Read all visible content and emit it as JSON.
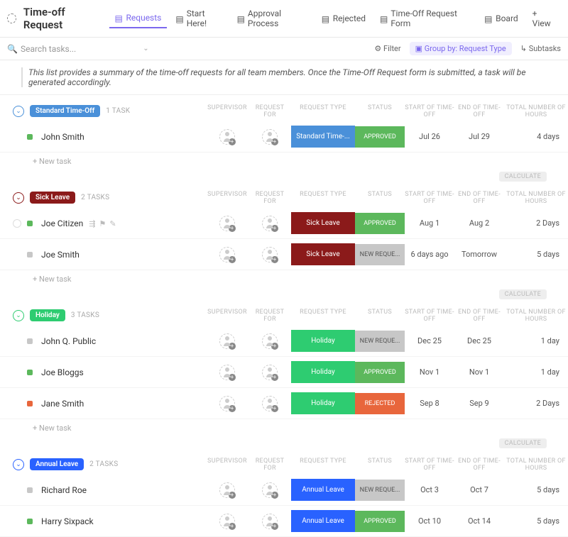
{
  "header": {
    "title": "Time-off Request",
    "views": [
      {
        "label": "Requests",
        "active": true
      },
      {
        "label": "Start Here!"
      },
      {
        "label": "Approval Process"
      },
      {
        "label": "Rejected"
      },
      {
        "label": "Time-Off Request Form"
      },
      {
        "label": "Board"
      }
    ],
    "add_view": "+ View"
  },
  "toolbar": {
    "search_placeholder": "Search tasks...",
    "filter": "Filter",
    "group_by": "Group by: Request Type",
    "subtasks": "Subtasks"
  },
  "description": "This list provides a summary of the time-off requests for all team members. Once the Time-Off Request form is submitted, a task will be generated accordingly.",
  "columns": {
    "supervisor": "SUPERVISOR",
    "request_for": "REQUEST FOR",
    "request_type": "REQUEST TYPE",
    "status": "STATUS",
    "start": "START OF TIME-OFF",
    "end": "END OF TIME-OFF",
    "total": "TOTAL NUMBER OF HOURS"
  },
  "new_task": "+ New task",
  "calculate": "CALCULATE",
  "colors": {
    "standard": "#4a90d9",
    "sick": "#8b1a1a",
    "holiday": "#2ecc71",
    "annual": "#2962ff",
    "approved": "#5cb85c",
    "new_request": "#c7c7c7",
    "rejected": "#e8663c"
  },
  "groups": [
    {
      "name": "Standard Time-Off",
      "count": "1 TASK",
      "color": "#4a90d9",
      "tasks": [
        {
          "name": "John Smith",
          "sq": "#5cb85c",
          "type": "Standard Time-...",
          "type_bg": "#4a90d9",
          "status": "APPROVED",
          "status_bg": "#5cb85c",
          "start": "Jul 26",
          "end": "Jul 29",
          "total": "4 days"
        }
      ]
    },
    {
      "name": "Sick Leave",
      "count": "2 TASKS",
      "color": "#8b1a1a",
      "tasks": [
        {
          "name": "Joe Citizen",
          "sq": "#5cb85c",
          "hover": true,
          "type": "Sick Leave",
          "type_bg": "#8b1a1a",
          "status": "APPROVED",
          "status_bg": "#5cb85c",
          "start": "Aug 1",
          "end": "Aug 2",
          "total": "2 Days"
        },
        {
          "name": "Joe Smith",
          "sq": "#c7c7c7",
          "type": "Sick Leave",
          "type_bg": "#8b1a1a",
          "status": "NEW REQUE...",
          "status_bg": "#c7c7c7",
          "status_color": "#555",
          "start": "6 days ago",
          "end": "Tomorrow",
          "total": "5 days"
        }
      ]
    },
    {
      "name": "Holiday",
      "count": "3 TASKS",
      "color": "#2ecc71",
      "tasks": [
        {
          "name": "John Q. Public",
          "sq": "#c7c7c7",
          "type": "Holiday",
          "type_bg": "#2ecc71",
          "status": "NEW REQUE...",
          "status_bg": "#c7c7c7",
          "status_color": "#555",
          "start": "Dec 25",
          "end": "Dec 25",
          "total": "1 day"
        },
        {
          "name": "Joe Bloggs",
          "sq": "#5cb85c",
          "type": "Holiday",
          "type_bg": "#2ecc71",
          "status": "APPROVED",
          "status_bg": "#5cb85c",
          "start": "Nov 1",
          "end": "Nov 1",
          "total": "1 day"
        },
        {
          "name": "Jane Smith",
          "sq": "#e8663c",
          "type": "Holiday",
          "type_bg": "#2ecc71",
          "status": "REJECTED",
          "status_bg": "#e8663c",
          "start": "Sep 8",
          "end": "Sep 9",
          "total": "2 Days"
        }
      ]
    },
    {
      "name": "Annual Leave",
      "count": "2 TASKS",
      "color": "#2962ff",
      "tasks": [
        {
          "name": "Richard Roe",
          "sq": "#c7c7c7",
          "type": "Annual Leave",
          "type_bg": "#2962ff",
          "status": "NEW REQUE...",
          "status_bg": "#c7c7c7",
          "status_color": "#555",
          "start": "Oct 3",
          "end": "Oct 7",
          "total": "5 days"
        },
        {
          "name": "Harry Sixpack",
          "sq": "#5cb85c",
          "type": "Annual Leave",
          "type_bg": "#2962ff",
          "status": "APPROVED",
          "status_bg": "#5cb85c",
          "start": "Oct 10",
          "end": "Oct 14",
          "total": "5 days"
        }
      ]
    }
  ]
}
